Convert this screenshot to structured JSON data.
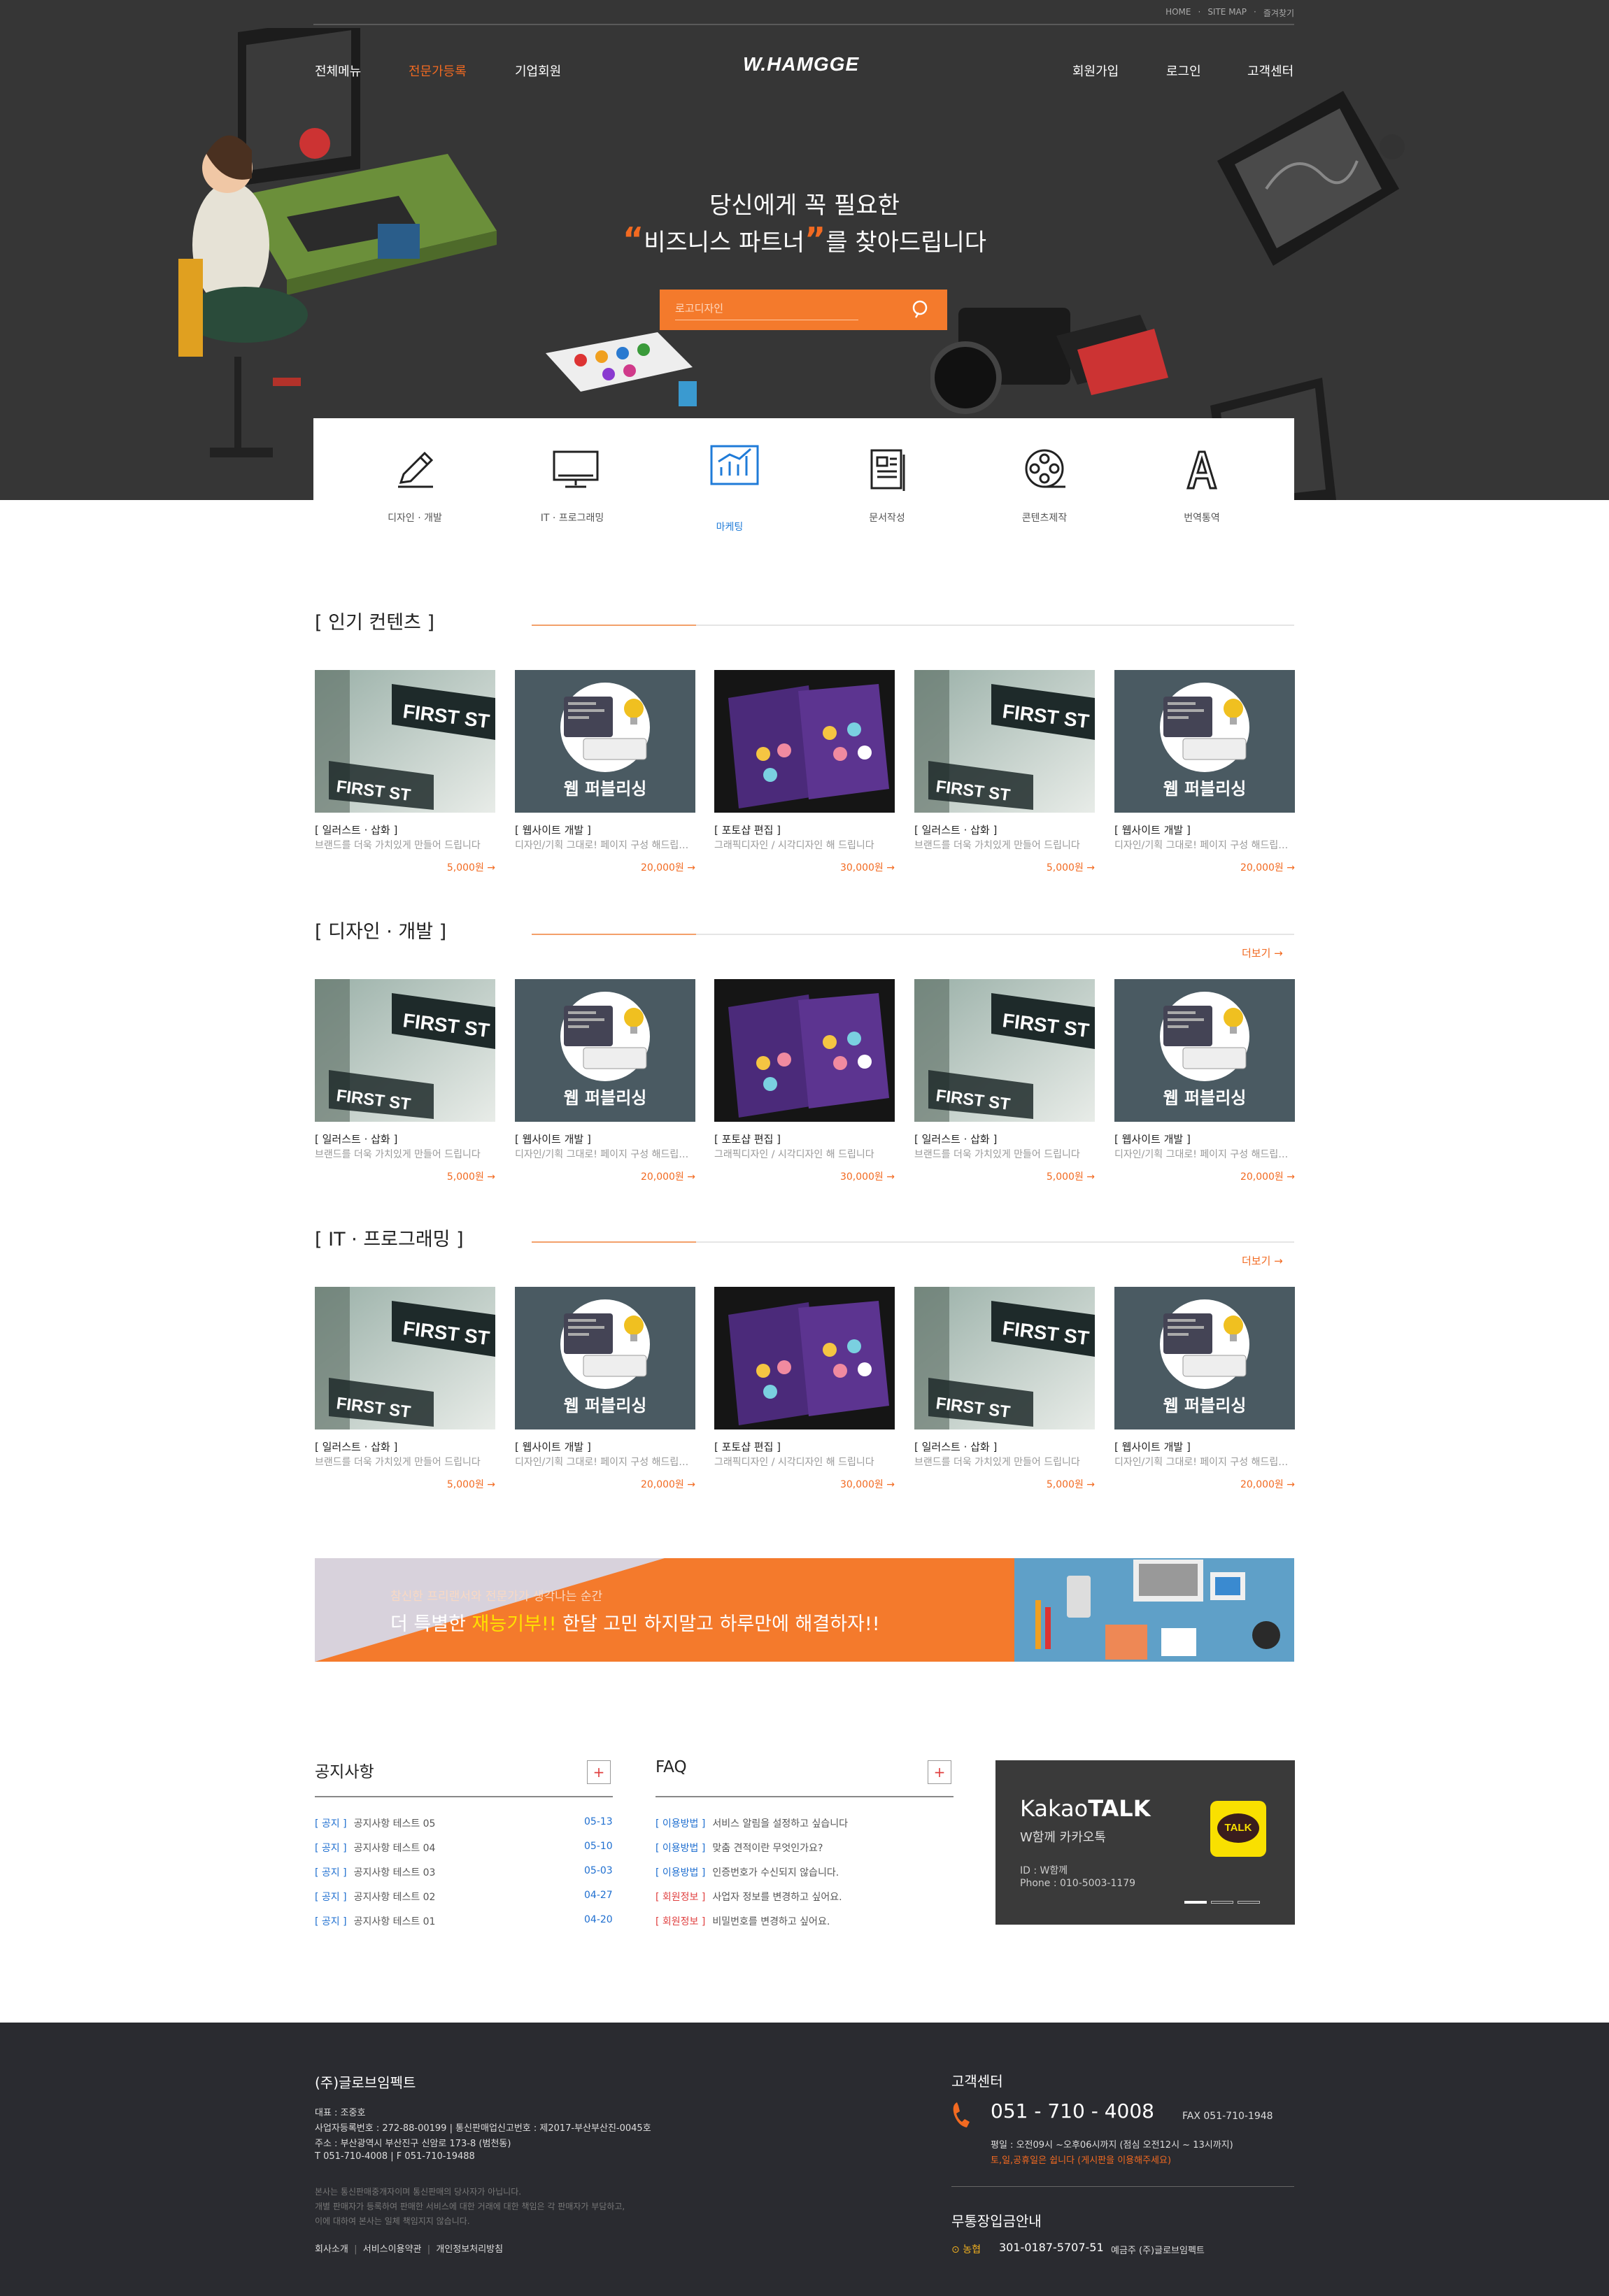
{
  "utility_links": [
    "HOME",
    "SITE MAP",
    "즐겨찾기"
  ],
  "nav_left": [
    {
      "label": "전체메뉴",
      "active": false
    },
    {
      "label": "전문가등록",
      "active": true
    },
    {
      "label": "기업회원",
      "active": false
    }
  ],
  "logo": "W.HAMGGE",
  "nav_right": [
    "회원가입",
    "로그인",
    "고객센터"
  ],
  "hero": {
    "line1": "당신에게 꼭 필요한",
    "open_quote": "“",
    "highlight": "비즈니스 파트너",
    "close_quote": "”",
    "line2_rest": "를 찾아드립니다"
  },
  "search": {
    "placeholder": "로고디자인"
  },
  "categories": [
    {
      "label": "디자인 · 개발",
      "icon": "pencil-icon",
      "active": false
    },
    {
      "label": "IT · 프로그래밍",
      "icon": "monitor-icon",
      "active": false
    },
    {
      "label": "마케팅",
      "icon": "chart-icon",
      "active": true
    },
    {
      "label": "문서작성",
      "icon": "document-icon",
      "active": false
    },
    {
      "label": "콘텐츠제작",
      "icon": "film-reel-icon",
      "active": false
    },
    {
      "label": "번역통역",
      "icon": "letter-a-icon",
      "active": false
    }
  ],
  "sections": [
    {
      "title": "[ 인기 컨텐츠 ]",
      "more": "",
      "cards": [
        {
          "category": "[ 일러스트 · 삽화 ]",
          "desc": "브랜드를 더욱 가치있게 만들어 드립니다",
          "price": "5,000원 →",
          "thumb": "street"
        },
        {
          "category": "[ 웹사이트 개발 ]",
          "desc": "디자인/기획 그대로! 페이지 구성 해드립니다",
          "price": "20,000원 →",
          "thumb": "web"
        },
        {
          "category": "[ 포토샵 편집 ]",
          "desc": "그래픽디자인 / 시각디자인 해 드립니다",
          "price": "30,000원 →",
          "thumb": "brochure"
        },
        {
          "category": "[ 일러스트 · 삽화 ]",
          "desc": "브랜드를 더욱 가치있게 만들어 드립니다",
          "price": "5,000원 →",
          "thumb": "street"
        },
        {
          "category": "[ 웹사이트 개발 ]",
          "desc": "디자인/기획 그대로! 페이지 구성 해드립니다",
          "price": "20,000원 →",
          "thumb": "web"
        }
      ]
    },
    {
      "title": "[ 디자인 · 개발 ]",
      "more": "더보기 →",
      "cards": [
        {
          "category": "[ 일러스트 · 삽화 ]",
          "desc": "브랜드를 더욱 가치있게 만들어 드립니다",
          "price": "5,000원 →",
          "thumb": "street"
        },
        {
          "category": "[ 웹사이트 개발 ]",
          "desc": "디자인/기획 그대로! 페이지 구성 해드립니다",
          "price": "20,000원 →",
          "thumb": "web"
        },
        {
          "category": "[ 포토샵 편집 ]",
          "desc": "그래픽디자인 / 시각디자인 해 드립니다",
          "price": "30,000원 →",
          "thumb": "brochure"
        },
        {
          "category": "[ 일러스트 · 삽화 ]",
          "desc": "브랜드를 더욱 가치있게 만들어 드립니다",
          "price": "5,000원 →",
          "thumb": "street"
        },
        {
          "category": "[ 웹사이트 개발 ]",
          "desc": "디자인/기획 그대로! 페이지 구성 해드립니다",
          "price": "20,000원 →",
          "thumb": "web"
        }
      ]
    },
    {
      "title": "[ IT · 프로그래밍 ]",
      "more": "더보기 →",
      "cards": [
        {
          "category": "[ 일러스트 · 삽화 ]",
          "desc": "브랜드를 더욱 가치있게 만들어 드립니다",
          "price": "5,000원 →",
          "thumb": "street"
        },
        {
          "category": "[ 웹사이트 개발 ]",
          "desc": "디자인/기획 그대로! 페이지 구성 해드립니다",
          "price": "20,000원 →",
          "thumb": "web"
        },
        {
          "category": "[ 포토샵 편집 ]",
          "desc": "그래픽디자인 / 시각디자인 해 드립니다",
          "price": "30,000원 →",
          "thumb": "brochure"
        },
        {
          "category": "[ 일러스트 · 삽화 ]",
          "desc": "브랜드를 더욱 가치있게 만들어 드립니다",
          "price": "5,000원 →",
          "thumb": "street"
        },
        {
          "category": "[ 웹사이트 개발 ]",
          "desc": "디자인/기획 그대로! 페이지 구성 해드립니다",
          "price": "20,000원 →",
          "thumb": "web"
        }
      ]
    }
  ],
  "thumb_text": {
    "street": "FIRST ST",
    "web": "웹 퍼블리싱"
  },
  "banner": {
    "small": "참신한 프리랜서와 전문가가 생각나는 순간",
    "pre": "더 특별한 ",
    "highlight": "재능기부!!",
    "post": " 한달 고민 하지말고 하루만에 해결하자!!"
  },
  "notice": {
    "title": "공지사항",
    "plus": "+",
    "items": [
      {
        "tag": "[ 공지 ]",
        "text": "공지사항 테스트 05",
        "date": "05-13"
      },
      {
        "tag": "[ 공지 ]",
        "text": "공지사항 테스트 04",
        "date": "05-10"
      },
      {
        "tag": "[ 공지 ]",
        "text": "공지사항 테스트 03",
        "date": "05-03"
      },
      {
        "tag": "[ 공지 ]",
        "text": "공지사항 테스트 02",
        "date": "04-27"
      },
      {
        "tag": "[ 공지 ]",
        "text": "공지사항 테스트 01",
        "date": "04-20"
      }
    ]
  },
  "faq": {
    "title": "FAQ",
    "plus": "+",
    "items": [
      {
        "tag": "[ 이용방법 ]",
        "text": "서비스 알림을 설정하고 싶습니다"
      },
      {
        "tag": "[ 이용방법 ]",
        "text": "맞춤 견적이란 무엇인가요?"
      },
      {
        "tag": "[ 이용방법 ]",
        "text": "인증번호가 수신되지 않습니다."
      },
      {
        "tag": "[ 회원정보 ]",
        "text": "사업자 정보를 변경하고 싶어요."
      },
      {
        "tag": "[ 회원정보 ]",
        "text": "비밀번호를 변경하고 싶어요."
      }
    ]
  },
  "kakao": {
    "brand_light": "Kakao",
    "brand_bold": "TALK",
    "subtitle": "W함께 카카오톡",
    "id": "ID : W함께",
    "phone": "Phone : 010-5003-1179",
    "badge": "TALK"
  },
  "footer": {
    "company": "(주)글로브임펙트",
    "info": [
      "대표 : 조중호",
      "사업자등록번호 : 272-88-00199   |   통신판매업신고번호 : 제2017-부산부산진-0045호",
      "주소 : 부산광역시 부산진구 신암로 173-8 (범천동)",
      "T 051-710-4008   |   F 051-710-19488"
    ],
    "disclaimer": [
      "본사는 통신판매중개자이며 통신판매의 당사자가 아닙니다.",
      "개별 판매자가 등록하여 판매한 서비스에 대한 거래에 대한 책임은 각 판매자가 부담하고,",
      "이에 대하여 본사는 일체 책임지지 않습니다."
    ],
    "links": [
      "회사소개",
      "서비스이용약관",
      "개인정보처리방침"
    ],
    "cs_title": "고객센터",
    "cs_phone": "051 - 710 - 4008",
    "cs_fax": "FAX 051-710-1948",
    "cs_hours": "평일 : 오전09시 ~오후06시까지 (점심 오전12시 ~ 13시까지)",
    "cs_note": "토,일,공휴일은 쉽니다 (게시판을 이용해주세요)",
    "bank_title": "무통장입금안내",
    "bank_name": "농협",
    "bank_account": "301-0187-5707-51",
    "bank_holder": "예금주 (주)글로브임펙트"
  },
  "colors": {
    "accent": "#f26a21",
    "dark": "#363636",
    "link_blue": "#1f6fd0",
    "footer_bg": "#2a2b30"
  }
}
